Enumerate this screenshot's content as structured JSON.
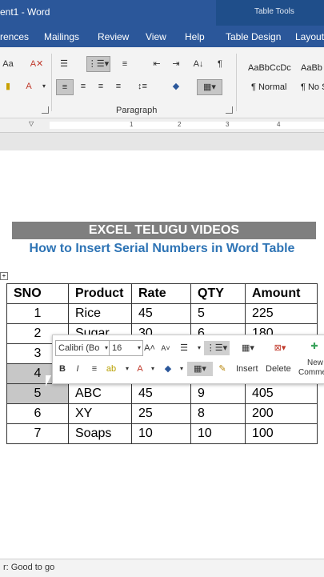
{
  "app": {
    "title": "ent1 - Word",
    "table_tools_label": "Table Tools"
  },
  "tabs": [
    {
      "label": "rences"
    },
    {
      "label": "Mailings"
    },
    {
      "label": "Review"
    },
    {
      "label": "View"
    },
    {
      "label": "Help"
    },
    {
      "label": "Table Design"
    },
    {
      "label": "Layout"
    }
  ],
  "ribbon": {
    "paragraph_label": "Paragraph",
    "styles": [
      {
        "preview": "AaBbCcDc",
        "name": "¶ Normal"
      },
      {
        "preview": "AaBb",
        "name": "¶ No S"
      }
    ]
  },
  "document": {
    "banner": "EXCEL TELUGU VIDEOS",
    "subtitle": "How to Insert Serial Numbers in Word Table",
    "table": {
      "headers": [
        "SNO",
        "Product",
        "Rate",
        "QTY",
        "Amount"
      ],
      "rows": [
        [
          "1",
          "Rice",
          "45",
          "5",
          "225"
        ],
        [
          "2",
          "Sugar",
          "30",
          "6",
          "180"
        ],
        [
          "3",
          "",
          "",
          "",
          ""
        ],
        [
          "4",
          "",
          "",
          "",
          ""
        ],
        [
          "5",
          "ABC",
          "45",
          "9",
          "405"
        ],
        [
          "6",
          "XY",
          "25",
          "8",
          "200"
        ],
        [
          "7",
          "Soaps",
          "10",
          "10",
          "100"
        ]
      ]
    }
  },
  "mini_toolbar": {
    "font_name": "Calibri (Bo",
    "font_size": "16",
    "insert_label": "Insert",
    "delete_label": "Delete",
    "new_comment_label_1": "New",
    "new_comment_label_2": "Comme"
  },
  "status": {
    "text": "r: Good to go"
  },
  "colors": {
    "title_blue": "#2b579a",
    "subtitle_blue": "#2e74b5",
    "banner_gray": "#7f7f7f"
  }
}
